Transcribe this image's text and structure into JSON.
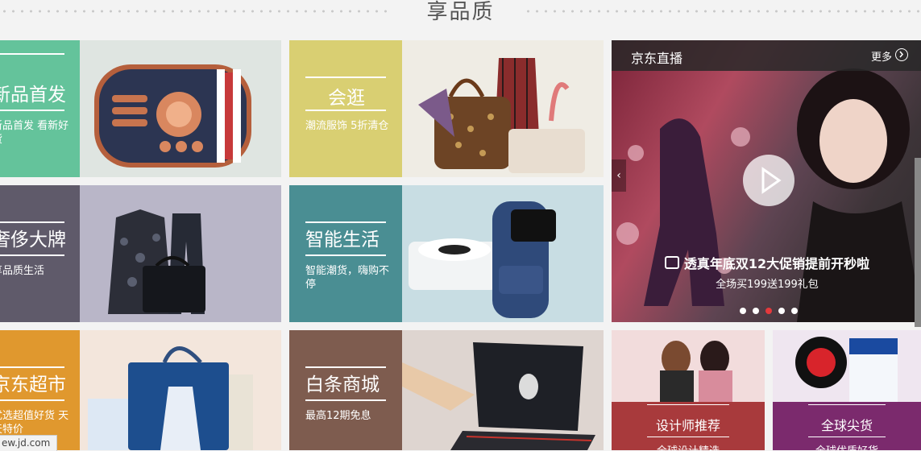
{
  "section": {
    "title": "享品质"
  },
  "tiles": [
    {
      "id": "new",
      "title": "新品首发",
      "desc": "新品首发 看新好货",
      "color": "#64c39b"
    },
    {
      "id": "stroll",
      "title": "会逛",
      "desc": "潮流服饰 5折清仓",
      "color": "#d9cf72"
    },
    {
      "id": "luxury",
      "title": "奢侈大牌",
      "desc": "享品质生活",
      "color": "#5f5a6a"
    },
    {
      "id": "smart",
      "title": "智能生活",
      "desc": "智能潮货，嗨购不停",
      "color": "#4a8e93"
    },
    {
      "id": "market",
      "title": "京东超市",
      "desc": "优选超值好货 天天特价",
      "color": "#e0982e"
    },
    {
      "id": "baitiao",
      "title": "白条商城",
      "desc": "最高12期免息",
      "color": "#7e5c4f"
    }
  ],
  "live": {
    "title": "京东直播",
    "more": "更多",
    "caption": "透真年底双12大促销提前开秒啦",
    "sub": "全场买199送199礼包",
    "active_dot": 3,
    "dot_count": 5
  },
  "small_tiles": [
    {
      "label": "设计师推荐",
      "sub": "全球设计精选",
      "bar_color": "#a83a3c"
    },
    {
      "label": "全球尖货",
      "sub": "全球优质好货",
      "bar_color": "#7b2a6d"
    }
  ],
  "status_url": "ew.jd.com"
}
